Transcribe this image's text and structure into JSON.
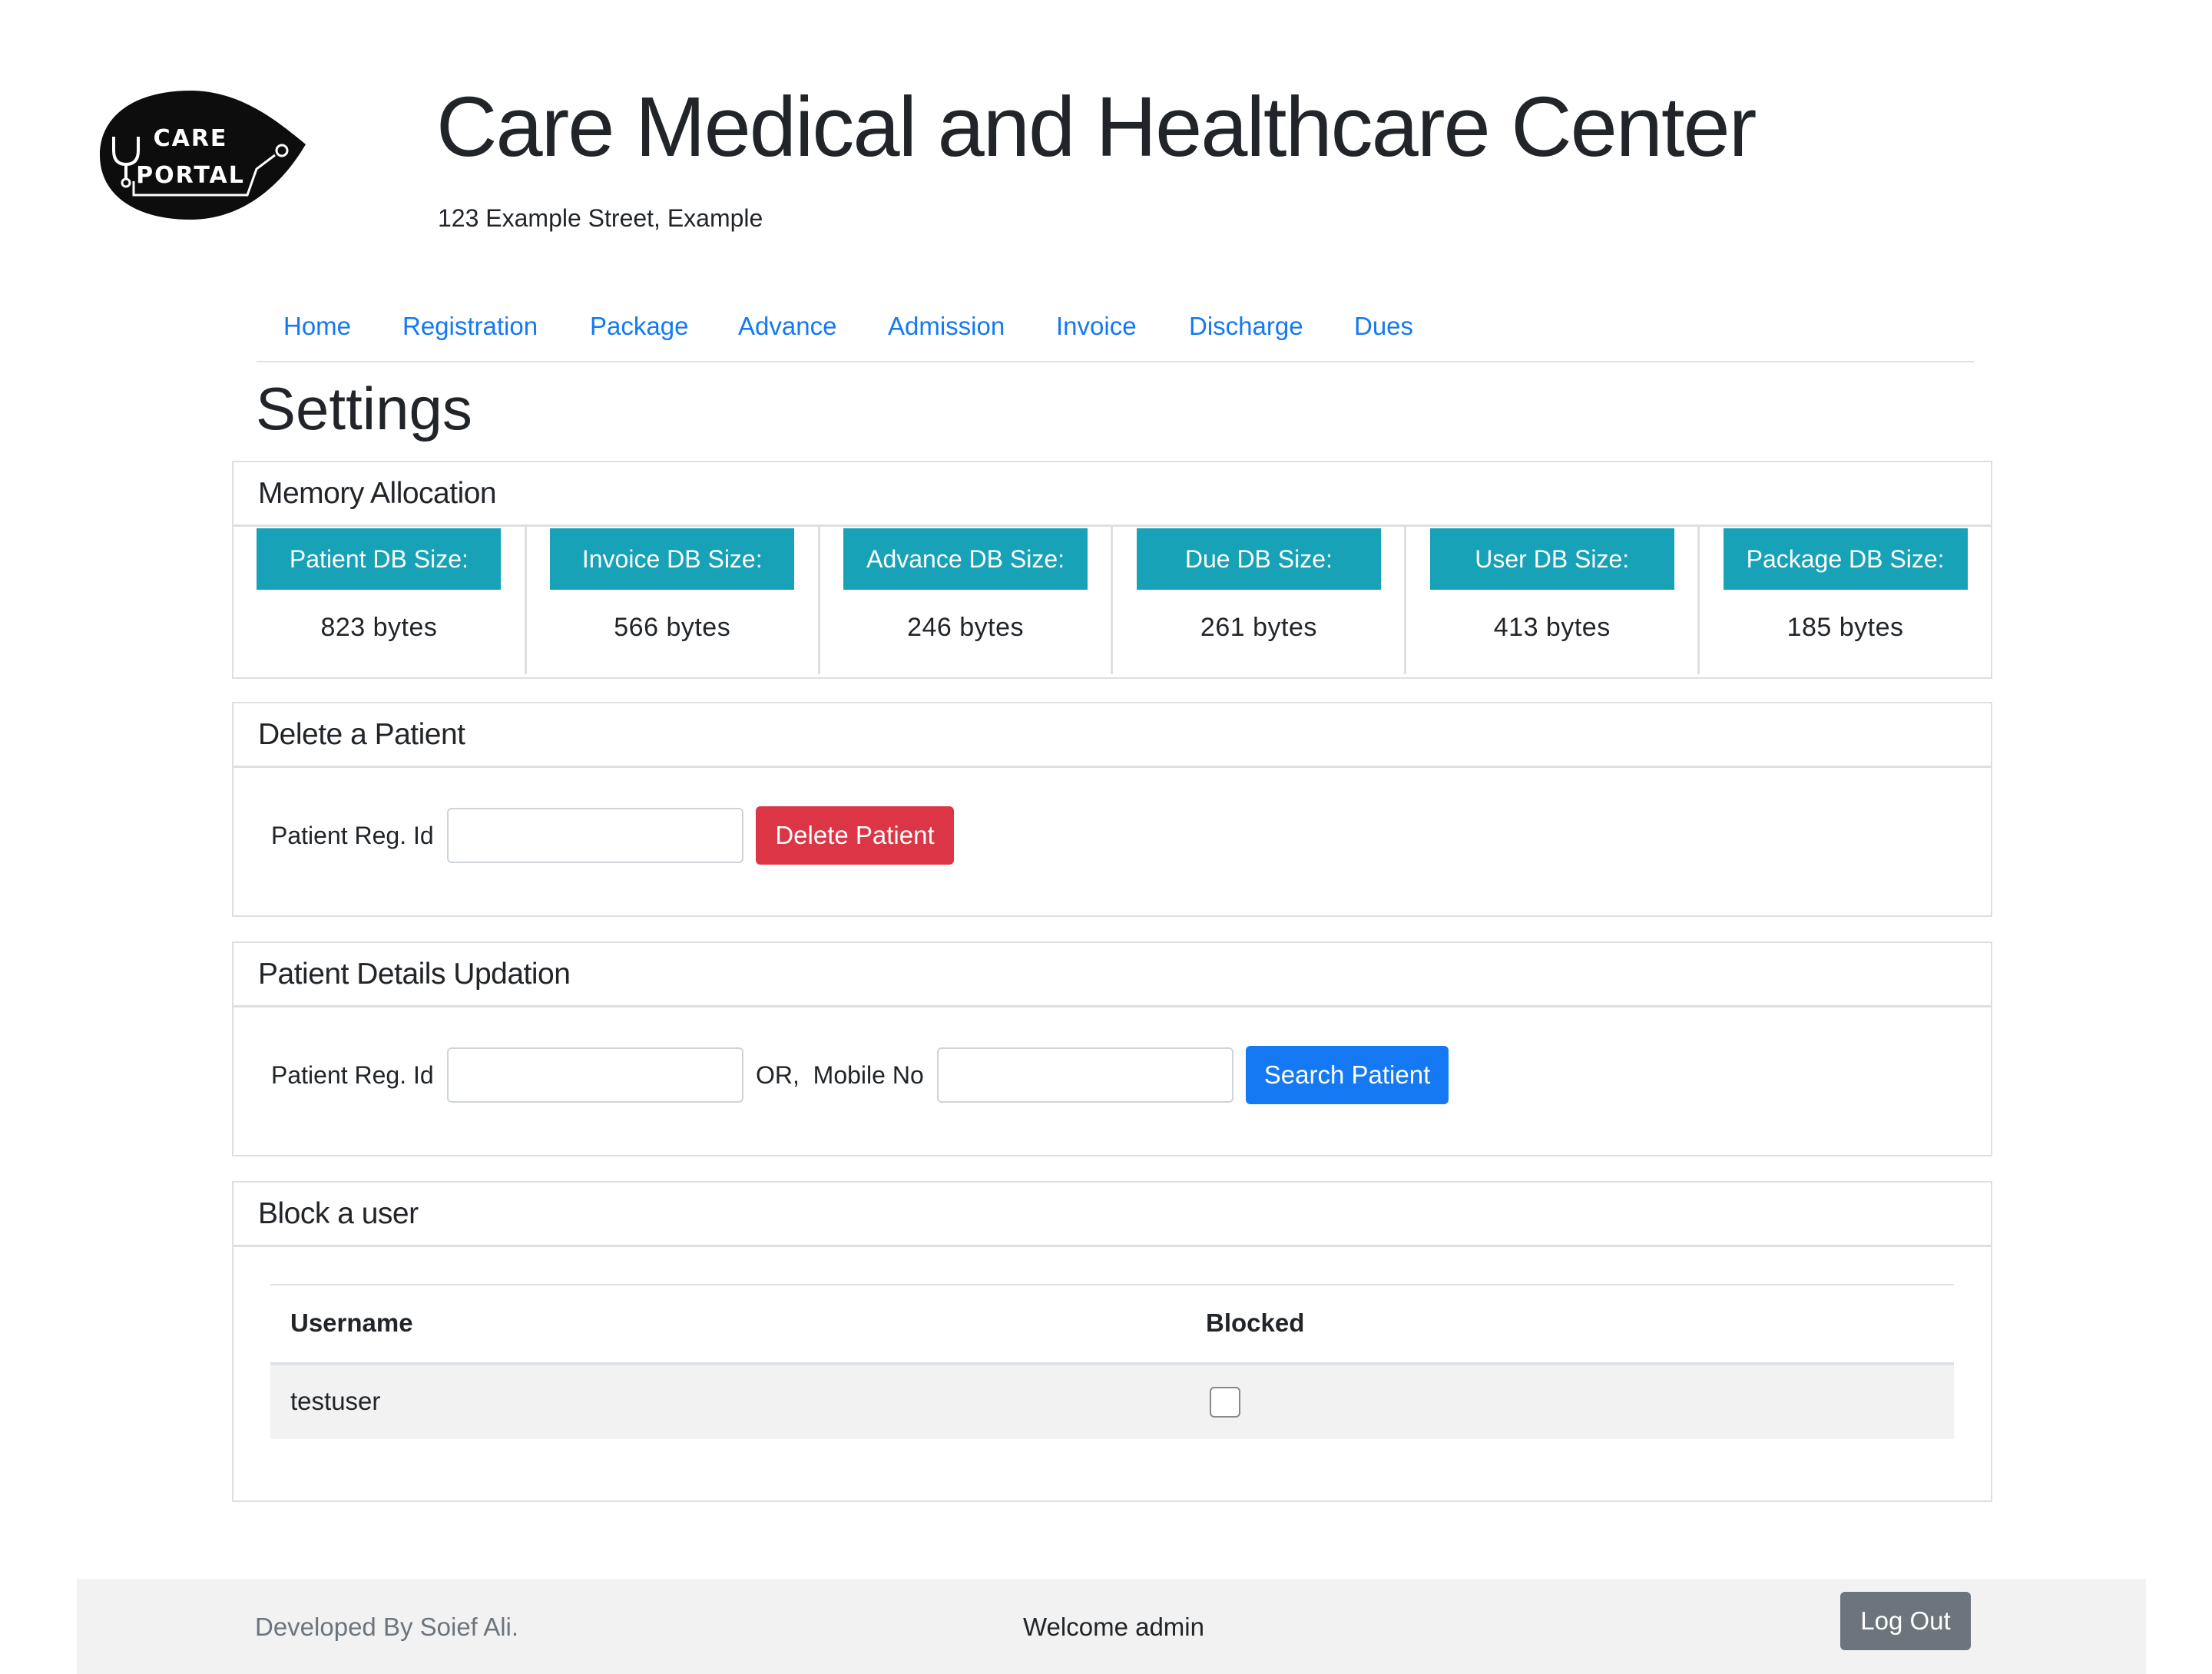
{
  "logo": {
    "line1": "CARE",
    "line2": "PORTAL"
  },
  "header": {
    "title": "Care Medical and Healthcare Center",
    "address": "123 Example Street, Example"
  },
  "nav": {
    "items": [
      {
        "label": "Home"
      },
      {
        "label": "Registration"
      },
      {
        "label": "Package"
      },
      {
        "label": "Advance"
      },
      {
        "label": "Admission"
      },
      {
        "label": "Invoice"
      },
      {
        "label": "Discharge"
      },
      {
        "label": "Dues"
      }
    ]
  },
  "page": {
    "heading": "Settings"
  },
  "memory": {
    "title": "Memory Allocation",
    "items": [
      {
        "label": "Patient DB Size:",
        "value": "823 bytes"
      },
      {
        "label": "Invoice DB Size:",
        "value": "566 bytes"
      },
      {
        "label": "Advance DB Size:",
        "value": "246 bytes"
      },
      {
        "label": "Due DB Size:",
        "value": "261 bytes"
      },
      {
        "label": "User DB Size:",
        "value": "413 bytes"
      },
      {
        "label": "Package DB Size:",
        "value": "185 bytes"
      }
    ]
  },
  "delete_patient": {
    "title": "Delete a Patient",
    "reg_label": "Patient Reg. Id",
    "reg_value": "",
    "button": "Delete Patient"
  },
  "update_patient": {
    "title": "Patient Details Updation",
    "reg_label": "Patient Reg. Id",
    "reg_value": "",
    "or_label": "OR,  Mobile No",
    "mobile_value": "",
    "button": "Search Patient"
  },
  "block_user": {
    "title": "Block a user",
    "columns": [
      "Username",
      "Blocked"
    ],
    "rows": [
      {
        "username": "testuser",
        "blocked": false
      }
    ]
  },
  "footer": {
    "developer": "Developed By Soief Ali.",
    "welcome": "Welcome admin",
    "logout": "Log Out"
  },
  "colors": {
    "link": "#1479f2",
    "info": "#17a2b8",
    "danger": "#dc3545",
    "secondary": "#6c757d"
  }
}
